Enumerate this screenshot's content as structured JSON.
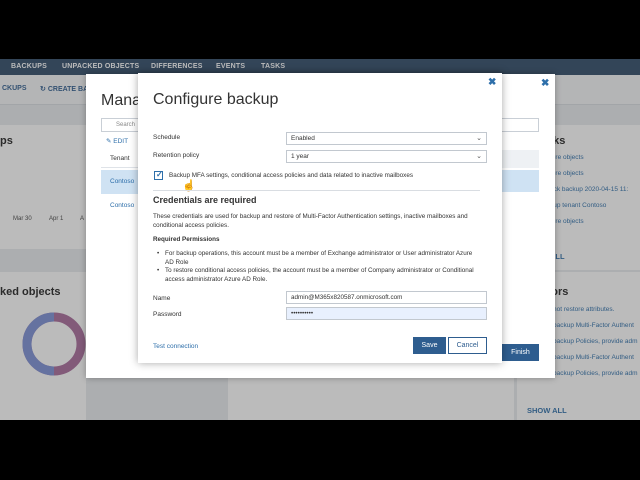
{
  "nav": {
    "tabs": [
      "BACKUPS",
      "UNPACKED OBJECTS",
      "DIFFERENCES",
      "EVENTS",
      "TASKS"
    ]
  },
  "toolbar": {
    "backups_label": "CKUPS",
    "create_label": "CREATE BA"
  },
  "background": {
    "left_top_title": "ps",
    "axis_labels": [
      "Mar 30",
      "Apr 1",
      "A"
    ],
    "unpacked_title": "ked objects",
    "tasks_title": "sks",
    "tasks_items": [
      "tore objects",
      "tore objects",
      "ack backup 2020-04-15 11:",
      "kup tenant Contoso",
      "tore objects"
    ],
    "tasks_show_all": "ALL",
    "errors_title": "rors",
    "errors_items": [
      "not restore attributes.",
      "backup Multi-Factor Authent",
      "backup Policies, provide adm",
      "backup Multi-Factor Authent",
      "backup Policies, provide adm"
    ],
    "errors_show_all": "SHOW ALL",
    "colors": {
      "donut_a": "#7b8fd6",
      "donut_b": "#a86a9a",
      "nav": "#2e4a68",
      "accent": "#2e5d8f"
    }
  },
  "wizard": {
    "title": "Mana",
    "search_placeholder": "Search",
    "edit_label": "EDIT",
    "column_tenant": "Tenant",
    "rows": [
      "Contoso",
      "Contoso"
    ],
    "finish_label": "Finish",
    "close_icon": "close-icon"
  },
  "dialog": {
    "title": "Configure backup",
    "schedule_label": "Schedule",
    "schedule_value": "Enabled",
    "retention_label": "Retention policy",
    "retention_value": "1 year",
    "mfa_checkbox_label": "Backup MFA settings, conditional access policies and data related to inactive mailboxes",
    "mfa_checked": true,
    "credentials_title": "Credentials are required",
    "credentials_desc": "These credentials are used for backup and restore of Multi-Factor Authentication settings, inactive mailboxes and conditional access policies.",
    "required_permissions": "Required Permissions",
    "bullets": [
      "For backup operations, this account must be a member of Exchange administrator or User administrator Azure AD Role",
      "To restore conditional access policies, the account must be a member of Company administrator or Conditional access administrator Azure AD Role."
    ],
    "name_label": "Name",
    "name_value": "admin@M365x820587.onmicrosoft.com",
    "password_label": "Password",
    "password_value": "••••••••••",
    "test_connection": "Test connection",
    "save_label": "Save",
    "cancel_label": "Cancel"
  }
}
